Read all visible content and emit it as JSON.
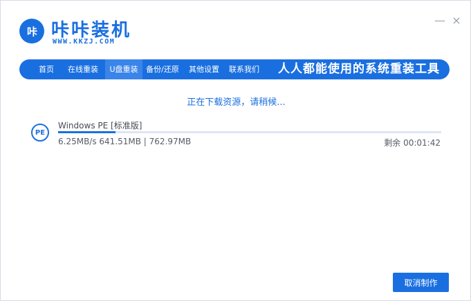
{
  "header": {
    "logo_mark": "咔",
    "brand_name": "咔咔装机",
    "brand_url": "WWW.KKZJ.COM",
    "minimize_glyph": "—",
    "close_glyph": "×"
  },
  "nav": {
    "items": [
      {
        "label": "首页"
      },
      {
        "label": "在线重装"
      },
      {
        "label": "U盘重装"
      },
      {
        "label": "备份/还原"
      },
      {
        "label": "其他设置"
      },
      {
        "label": "联系我们"
      }
    ],
    "active_index": 2,
    "slogan": "人人都能使用的系统重装工具"
  },
  "status": {
    "text": "正在下载资源，请稍候..."
  },
  "download": {
    "badge": "PE",
    "name": "Windows PE [标准版]",
    "speed": "6.25MB/s",
    "downloaded": "641.51MB",
    "total": "762.97MB",
    "stats": "6.25MB/s 641.51MB | 762.97MB",
    "remaining_label": "剩余",
    "remaining_time": "00:01:42",
    "remaining": "剩余 00:01:42",
    "progress_fraction": 0.15
  },
  "actions": {
    "cancel_label": "取消制作"
  },
  "colors": {
    "accent": "#1a6fe0",
    "nav_active": "#3a85ea",
    "track": "#dde6f3"
  }
}
